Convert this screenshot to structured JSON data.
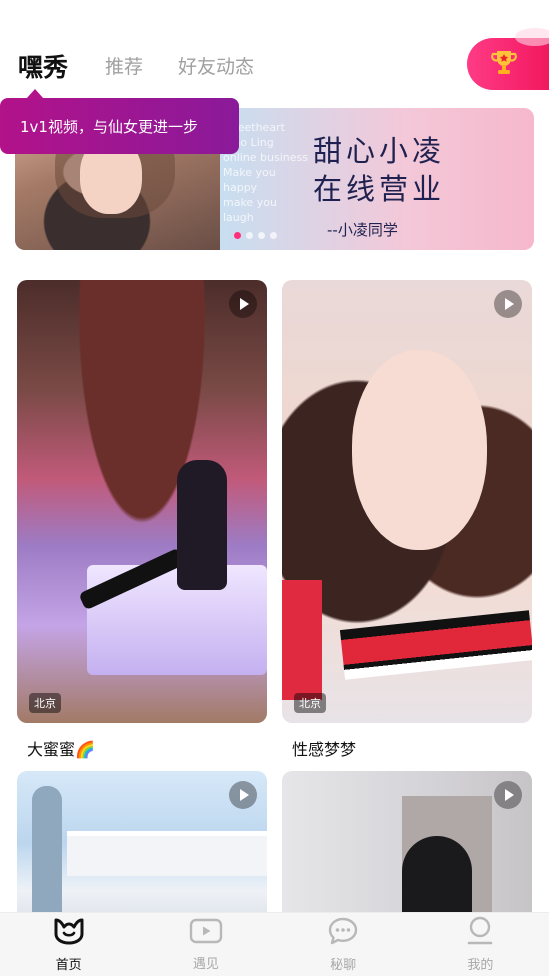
{
  "header": {
    "tabs": [
      {
        "label": "嘿秀",
        "active": true
      },
      {
        "label": "推荐",
        "active": false
      },
      {
        "label": "好友动态",
        "active": false
      }
    ],
    "trophy_icon": "trophy-icon"
  },
  "tooltip": {
    "text": "1v1视频，与仙女更进一步"
  },
  "banner": {
    "english_lines": [
      "sweetheart",
      "Xiao Ling",
      "online business",
      "Make you",
      "happy",
      "make you",
      "laugh"
    ],
    "headline_line1": "甜心小凌",
    "headline_line2": "在线营业",
    "signature": "--小凌同学",
    "dots": 4,
    "active_dot": 0
  },
  "cards": [
    {
      "title": "大蜜蜜🌈",
      "location": "北京",
      "icon": "play-icon"
    },
    {
      "title": "性感梦梦",
      "location": "北京",
      "icon": "play-icon"
    },
    {
      "title": "",
      "location": "",
      "icon": "play-icon"
    },
    {
      "title": "",
      "location": "",
      "icon": "play-icon"
    }
  ],
  "nav": [
    {
      "label": "首页",
      "icon": "home-logo-icon",
      "active": true
    },
    {
      "label": "遇见",
      "icon": "video-play-icon",
      "active": false
    },
    {
      "label": "秘聊",
      "icon": "chat-bubble-icon",
      "active": false
    },
    {
      "label": "我的",
      "icon": "profile-icon",
      "active": false
    }
  ],
  "colors": {
    "accent": "#ff2f7a",
    "tooltip": "#a0148f",
    "text_primary": "#111111",
    "text_muted": "#a0a0a0"
  }
}
